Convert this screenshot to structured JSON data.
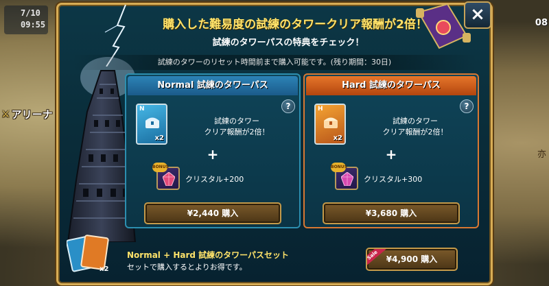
{
  "background": {
    "counter_top": "7/10",
    "counter_bottom": "09:55",
    "arena_label": "アリーナ",
    "right_text_top": "08",
    "right_text_mid": "亦"
  },
  "dialog": {
    "title": "購入した難易度の試練のタワークリア報酬が2倍！",
    "subtitle": "試練のタワーパスの特典をチェック！",
    "reset_notice": "試練のタワーのリセット時間前まで購入可能です。(残り期間：30日)",
    "close_label": "×",
    "help_label": "?"
  },
  "passes": [
    {
      "level": "Normal",
      "name": "試練のタワーパス",
      "letter": "N",
      "multiplier": "x2",
      "benefit": "試練のタワー\nクリア報酬が2倍！",
      "plus": "+",
      "bonus_tag": "BONUS",
      "crystal_label": "クリスタル",
      "crystal_amount": "+200",
      "price": "¥2,440 購入",
      "color": "#2c83b7"
    },
    {
      "level": "Hard",
      "name": "試練のタワーパス",
      "letter": "H",
      "multiplier": "x2",
      "benefit": "試練のタワー\nクリア報酬が2倍！",
      "plus": "+",
      "bonus_tag": "BONUS",
      "crystal_label": "クリスタル",
      "crystal_amount": "+300",
      "price": "¥3,680 購入",
      "color": "#e6762a"
    }
  ],
  "set": {
    "title_highlight": "Normal + Hard",
    "title_rest": " 試練のタワーパスセット",
    "description": "セットで購入するとよりお得です。",
    "multiplier": "x2",
    "sale_tag": "Sale",
    "price": "¥4,900 購入"
  }
}
